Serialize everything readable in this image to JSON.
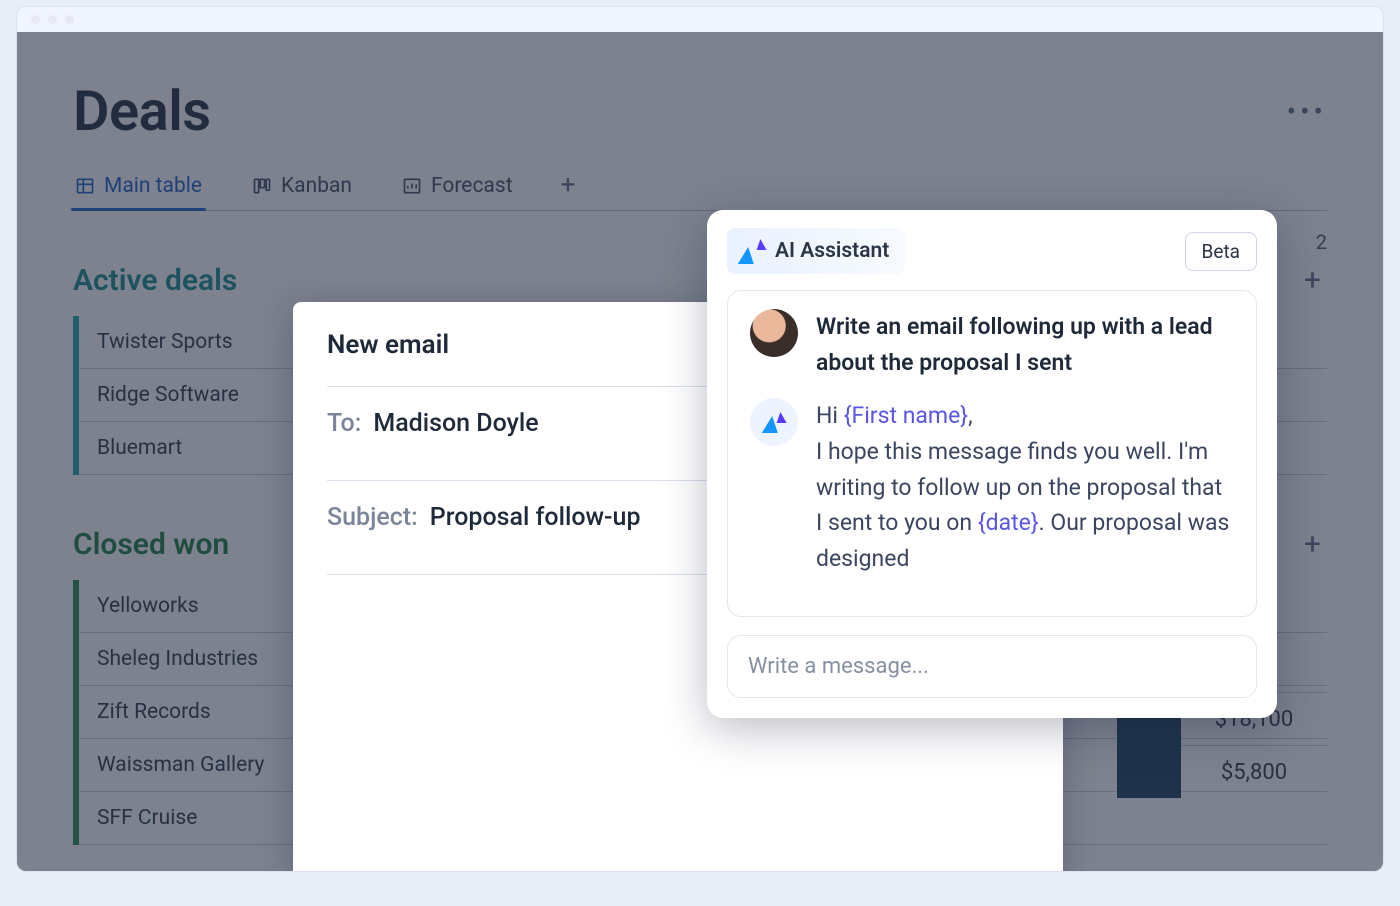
{
  "page": {
    "title": "Deals"
  },
  "tabs": {
    "items": [
      {
        "id": "main-table",
        "label": "Main table",
        "active": true
      },
      {
        "id": "kanban",
        "label": "Kanban",
        "active": false
      },
      {
        "id": "forecast",
        "label": "Forecast",
        "active": false
      }
    ],
    "add_label": "+"
  },
  "groups": {
    "active": {
      "title": "Active deals",
      "items": [
        "Twister Sports",
        "Ridge Software",
        "Bluemart"
      ]
    },
    "closed": {
      "title": "Closed won",
      "items": [
        "Yelloworks",
        "Sheleg Industries",
        "Zift Records",
        "Waissman Gallery",
        "SFF Cruise"
      ]
    }
  },
  "values_column": {
    "header_hint": "2",
    "rows": [
      {
        "status_color": "#123a55",
        "amount": "$18,100"
      },
      {
        "status_color": "#123a55",
        "amount": "$5,800"
      }
    ]
  },
  "email_compose": {
    "title": "New email",
    "to_label": "To:",
    "to_value": "Madison Doyle",
    "subject_label": "Subject:",
    "subject_value": "Proposal follow-up"
  },
  "ai_assistant": {
    "brand_label": "AI Assistant",
    "badge": "Beta",
    "user_prompt": "Write an email following up with a lead about the proposal I sent",
    "response": {
      "pre1": "Hi ",
      "tok1": "{First name}",
      "post1": ",",
      "line2": "I hope this message finds you well. I'm writing to follow up on the proposal that I sent to you on ",
      "tok2": "{date}",
      "post2": ". Our proposal was designed"
    },
    "input_placeholder": "Write a message..."
  },
  "colors": {
    "accent_blue": "#175ac8",
    "group_active": "#0f8a8a",
    "group_closed": "#157a3d",
    "token_purple": "#5a55e5"
  }
}
